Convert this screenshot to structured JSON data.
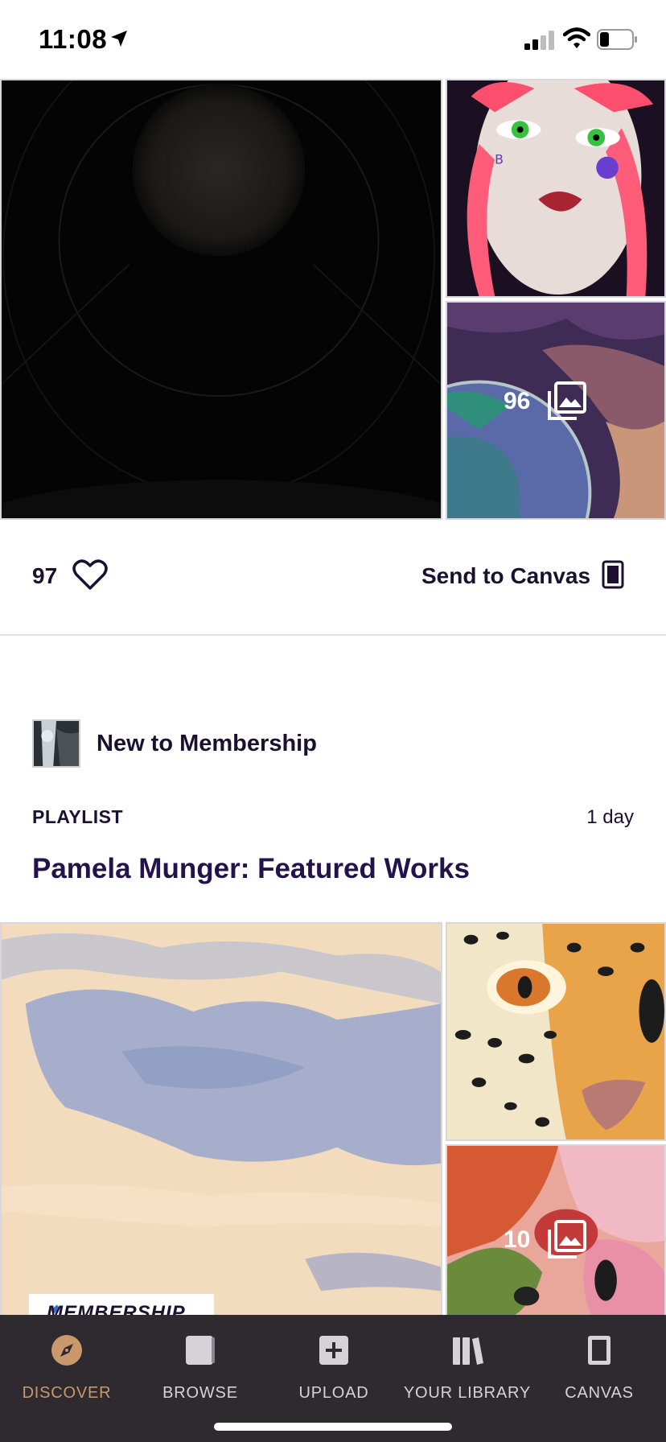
{
  "status_bar": {
    "time": "11:08"
  },
  "post1": {
    "overlay_count": "96",
    "like_count": "97",
    "send_to_canvas_label": "Send to Canvas"
  },
  "section": {
    "title": "New to Membership",
    "type_label": "PLAYLIST",
    "age": "1 day",
    "playlist_title": "Pamela Munger: Featured Works",
    "overlay_count": "10",
    "badge_text": "MEMBERSHIP"
  },
  "tabs": [
    {
      "label": "DISCOVER",
      "icon": "compass-icon",
      "active": true
    },
    {
      "label": "BROWSE",
      "icon": "browse-icon",
      "active": false
    },
    {
      "label": "UPLOAD",
      "icon": "upload-plus-icon",
      "active": false
    },
    {
      "label": "YOUR LIBRARY",
      "icon": "library-icon",
      "active": false
    },
    {
      "label": "CANVAS",
      "icon": "canvas-icon",
      "active": false
    }
  ],
  "colors": {
    "accent": "#c9986b",
    "tab_bar_bg": "#2e2a30",
    "text_primary": "#1c1030"
  }
}
